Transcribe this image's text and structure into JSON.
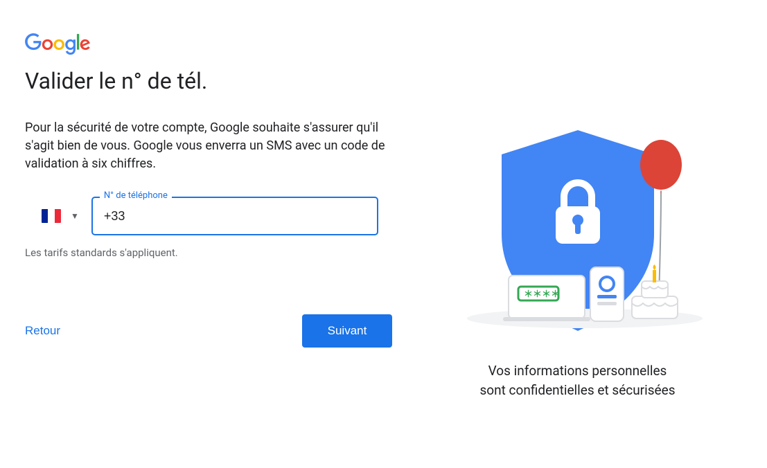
{
  "logo": {
    "name": "Google"
  },
  "heading": "Valider le n° de tél.",
  "description": "Pour la sécurité de votre compte, Google souhaite s'assurer qu'il s'agit bien de vous. Google vous enverra un SMS avec un code de validation à six chiffres.",
  "phone_field": {
    "label": "N° de téléphone",
    "value": "+33",
    "country": "France"
  },
  "disclaimer": "Les tarifs standards s'appliquent.",
  "buttons": {
    "back": "Retour",
    "next": "Suivant"
  },
  "right": {
    "caption_line1": "Vos informations personnelles",
    "caption_line2": "sont confidentielles et sécurisées"
  },
  "colors": {
    "primary": "#1a73e8",
    "text": "#202124",
    "muted": "#5f6368"
  }
}
